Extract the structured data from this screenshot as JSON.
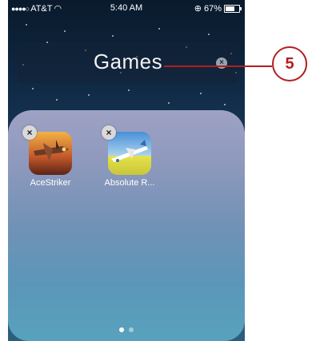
{
  "status_bar": {
    "carrier": "AT&T",
    "time": "5:40 AM",
    "battery": "67%",
    "battery_level": 0.67
  },
  "folder": {
    "title": "Games",
    "apps": [
      {
        "label": "AceStriker",
        "icon": "plane-fighter-icon"
      },
      {
        "label": "Absolute R...",
        "icon": "rc-plane-icon"
      }
    ],
    "page_count": 2,
    "current_page": 1
  },
  "callout": {
    "number": "5",
    "color": "#b0201f"
  }
}
